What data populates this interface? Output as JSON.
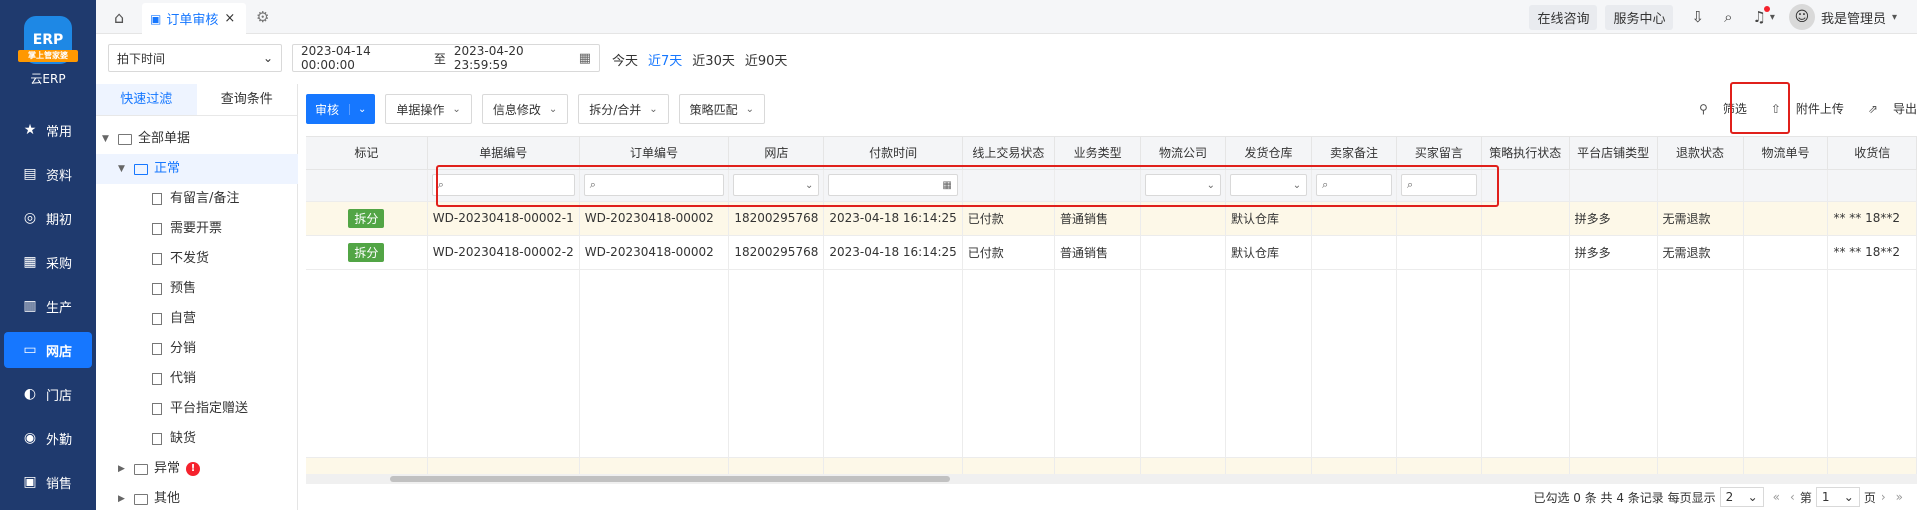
{
  "app": {
    "logo_text": "云ERP",
    "logo_ribbon": "掌上管家婆",
    "logo_mark": "ERP"
  },
  "nav": [
    {
      "label": "常用",
      "icon": "star-icon",
      "glyph": "★"
    },
    {
      "label": "资料",
      "icon": "document-icon",
      "glyph": "▤"
    },
    {
      "label": "期初",
      "icon": "target-icon",
      "glyph": "◎"
    },
    {
      "label": "采购",
      "icon": "purchase-icon",
      "glyph": "▦"
    },
    {
      "label": "生产",
      "icon": "factory-icon",
      "glyph": "▥"
    },
    {
      "label": "网店",
      "icon": "store-icon",
      "glyph": "▭",
      "active": true
    },
    {
      "label": "门店",
      "icon": "shop-icon",
      "glyph": "◐"
    },
    {
      "label": "外勤",
      "icon": "field-icon",
      "glyph": "◉"
    },
    {
      "label": "销售",
      "icon": "sales-icon",
      "glyph": "▣"
    }
  ],
  "topbar": {
    "tab_label": "订单审核",
    "consult": "在线咨询",
    "service": "服务中心",
    "user": "我是管理员"
  },
  "filters": {
    "date_type": "拍下时间",
    "start": "2023-04-14 00:00:00",
    "to": "至",
    "end": "2023-04-20 23:59:59",
    "quick": [
      "今天",
      "近7天",
      "近30天",
      "近90天"
    ],
    "quick_active": "近7天"
  },
  "tree": {
    "tabs": [
      "快速过滤",
      "查询条件"
    ],
    "root": "全部单据",
    "normal": "正常",
    "children": [
      "有留言/备注",
      "需要开票",
      "不发货",
      "预售",
      "自营",
      "分销",
      "代销",
      "平台指定赠送",
      "缺货"
    ],
    "abnormal": "异常",
    "abnormal_badge": "!",
    "other": "其他"
  },
  "toolbar": {
    "audit": "审核",
    "doc_ops": "单据操作",
    "info_edit": "信息修改",
    "split_merge": "拆分/合并",
    "strategy": "策略匹配",
    "filter": "筛选",
    "upload": "附件上传",
    "export": "导出"
  },
  "table": {
    "headers": [
      "标记",
      "单据编号",
      "订单编号",
      "网店",
      "付款时间",
      "线上交易状态",
      "业务类型",
      "物流公司",
      "发货仓库",
      "卖家备注",
      "买家留言",
      "策略执行状态",
      "平台店铺类型",
      "退款状态",
      "物流单号",
      "收货信"
    ],
    "rows": [
      [
        "拆分",
        "WD-20230418-00002-1",
        "WD-20230418-00002",
        "18200295768",
        "2023-04-18 16:14:25",
        "已付款",
        "普通销售",
        "",
        "默认仓库",
        "",
        "",
        "",
        "拼多多",
        "无需退款",
        "",
        "** ** 18**2"
      ],
      [
        "拆分",
        "WD-20230418-00002-2",
        "WD-20230418-00002",
        "18200295768",
        "2023-04-18 16:14:25",
        "已付款",
        "普通销售",
        "",
        "默认仓库",
        "",
        "",
        "",
        "拼多多",
        "无需退款",
        "",
        "** ** 18**2"
      ]
    ]
  },
  "pager": {
    "selected": "已勾选 0 条",
    "total": "共 4 条记录",
    "per_page_label": "每页显示",
    "per_page": "2",
    "page_label": "第",
    "page": "1",
    "page_suffix": "页"
  }
}
